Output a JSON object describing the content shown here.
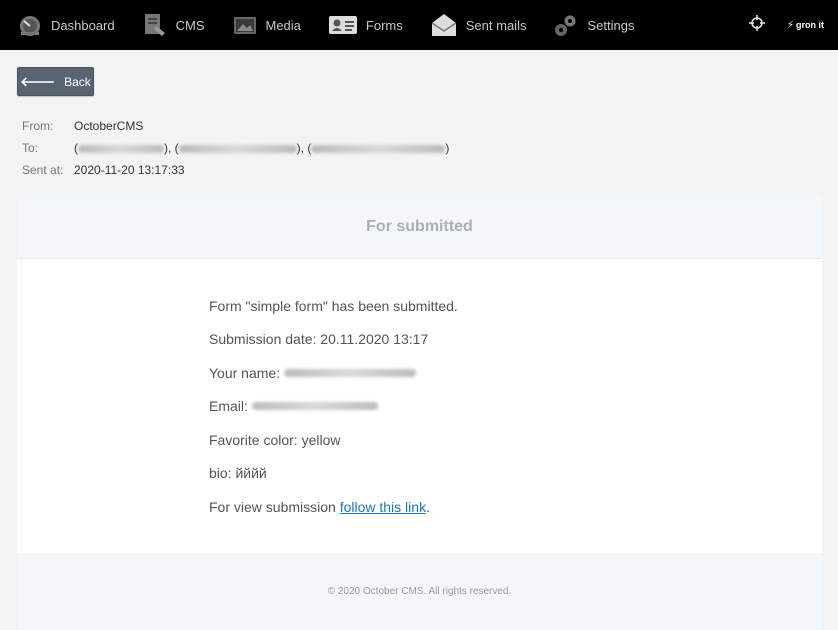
{
  "nav": {
    "items": [
      {
        "label": "Dashboard",
        "icon": "speedometer-icon"
      },
      {
        "label": "CMS",
        "icon": "cms-document-icon"
      },
      {
        "label": "Media",
        "icon": "media-image-icon"
      },
      {
        "label": "Forms",
        "icon": "id-card-icon"
      },
      {
        "label": "Sent mails",
        "icon": "envelope-open-icon"
      },
      {
        "label": "Settings",
        "icon": "gears-icon"
      }
    ],
    "brand": "gron it"
  },
  "back_button": {
    "label": "Back"
  },
  "meta": {
    "from_label": "From:",
    "from_value": "OctoberCMS",
    "to_label": "To:",
    "sent_label": "Sent at:",
    "sent_value": "2020-11-20 13:17:33"
  },
  "email": {
    "header_title": "For submitted",
    "line1": "Form \"simple form\" has been submitted.",
    "line2": "Submission date: 20.11.2020 13:17",
    "name_label": "Your name:",
    "email_label": "Email:",
    "color_line": "Favorite color: yellow",
    "bio_line": "bio: йййй",
    "view_prefix": "For view submission ",
    "view_link": "follow this link",
    "view_suffix": ".",
    "footer": "© 2020 October CMS. All rights reserved."
  },
  "colors": {
    "topbar": "#000000",
    "link": "#1a7ab8",
    "button": "#5a6470"
  }
}
